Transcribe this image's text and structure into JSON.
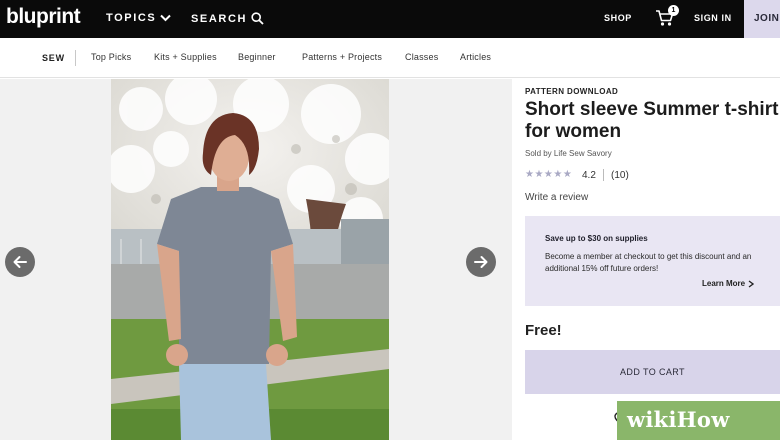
{
  "header": {
    "logo": "bluprint",
    "topics_label": "TOPICS",
    "search_label": "SEARCH",
    "shop_label": "SHOP",
    "cart_count": "1",
    "signin_label": "SIGN IN",
    "join_label": "JOIN"
  },
  "subnav": {
    "section": "SEW",
    "items": [
      "Top Picks",
      "Kits + Supplies",
      "Beginner",
      "Patterns + Projects",
      "Classes",
      "Articles"
    ]
  },
  "product": {
    "eyebrow": "PATTERN DOWNLOAD",
    "title_line1": "Short sleeve Summer t-shirt",
    "title_line2": "for women",
    "seller": "Sold by Life Sew Savory",
    "stars": "★★★★★",
    "rating": "4.2",
    "review_count": "(10)",
    "review_link": "Write a review",
    "price": "Free!",
    "add_to_cart": "ADD TO CART"
  },
  "promo": {
    "heading": "Save up to $30 on supplies",
    "text": "Become a member at checkout to get this discount and an additional 15% off future orders!",
    "link": "Learn More"
  },
  "watermark": "wikiHow",
  "colors": {
    "topbar": "#0a0a0a",
    "join_bg": "#dcd8ec",
    "promo_bg": "#e9e6f3",
    "cart_button_bg": "#d8d4ea",
    "arrow_bg": "#6b6b6b",
    "watermark_bg": "#8ab66a"
  }
}
